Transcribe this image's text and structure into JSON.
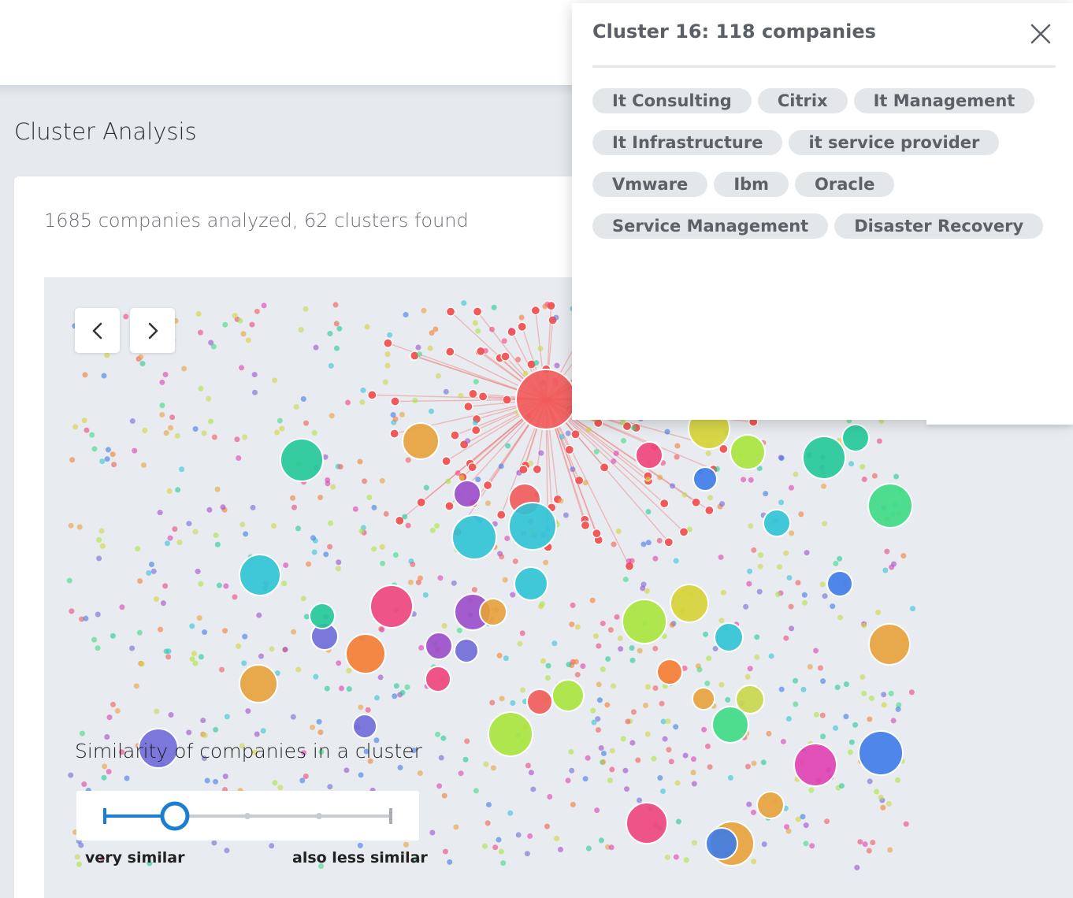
{
  "page": {
    "title": "Cluster Analysis"
  },
  "summary": {
    "text": "1685 companies analyzed, 62 clusters found"
  },
  "navigation": {
    "prev_icon": "chevron-left-icon",
    "next_icon": "chevron-right-icon"
  },
  "similarity": {
    "title": "Similarity of companies in a cluster",
    "left_label": "very similar",
    "right_label": "also less similar",
    "value_step": 2,
    "steps": 5,
    "accent": "#1a7fd4"
  },
  "panel": {
    "title": "Cluster 16: 118 companies",
    "close_icon": "close-icon",
    "tag_rows": [
      [
        "It Consulting",
        "Citrix",
        "It Management"
      ],
      [
        "It Infrastructure",
        "it service provider"
      ],
      [
        "Vmware",
        "Ibm",
        "Oracle"
      ],
      [
        "Service Management",
        "Disaster Recovery"
      ]
    ]
  },
  "colors": {
    "selected_cluster": "#f25a5a",
    "palette": [
      "#f25a5a",
      "#2ec4d6",
      "#a8e63c",
      "#3ddc84",
      "#9b4dca",
      "#e8a23a",
      "#f0447c",
      "#f57c30",
      "#d6d434",
      "#3d7be8",
      "#20c997",
      "#c9d84a",
      "#6f6ad8",
      "#e040b0"
    ]
  }
}
